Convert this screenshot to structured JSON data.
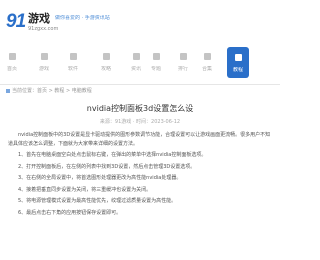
{
  "header": {
    "logo_mark": "91",
    "logo_word": "游戏",
    "logo_sub": "91zgxx.com",
    "slogan": "做你喜爱的 · 手游资讯站"
  },
  "nav": {
    "items": [
      {
        "label": "首页",
        "icon": "home-icon"
      },
      {
        "label": "游戏",
        "icon": "game-icon"
      },
      {
        "label": "软件",
        "icon": "app-icon"
      },
      {
        "label": "攻略",
        "icon": "guide-icon"
      },
      {
        "label": "资讯",
        "icon": "news-icon"
      },
      {
        "label": "专题",
        "icon": "topic-icon"
      },
      {
        "label": "排行",
        "icon": "rank-icon"
      },
      {
        "label": "合集",
        "icon": "collection-icon"
      },
      {
        "label": "教程",
        "icon": "tutorial-icon",
        "active": true
      }
    ],
    "active_color": "#2a6fc9"
  },
  "breadcrumb": "当前位置：首页 > 教程 > 电脑教程",
  "article": {
    "title": "nvidia控制面板3d设置怎么设",
    "meta": "来源：91游戏 · 时间：2023-06-12",
    "paragraphs": [
      "nvidia控制面板中的3D设置是显卡驱动提供的图形参数调节功能，合理设置可以让游戏画面更流畅。很多用户不知道具体应该怎么调整，下面就为大家带来详细的设置方法。",
      "1、首先在电脑桌面空白处点击鼠标右键，在弹出的菜单中选择nvidia控制面板选项。",
      "2、打开控制面板后，在左侧的列表中找到3D设置，然后点击管理3D设置选项。",
      "3、在右侧的全局设置中，将首选图形处理器更改为高性能nvidia处理器。",
      "4、接着把垂直同步设置为关闭，将三重缓冲也设置为关闭。",
      "5、将电源管理模式设置为最高性能优先，纹理过滤质量设置为高性能。",
      "6、最后点击右下角的应用按钮保存设置即可。"
    ]
  }
}
